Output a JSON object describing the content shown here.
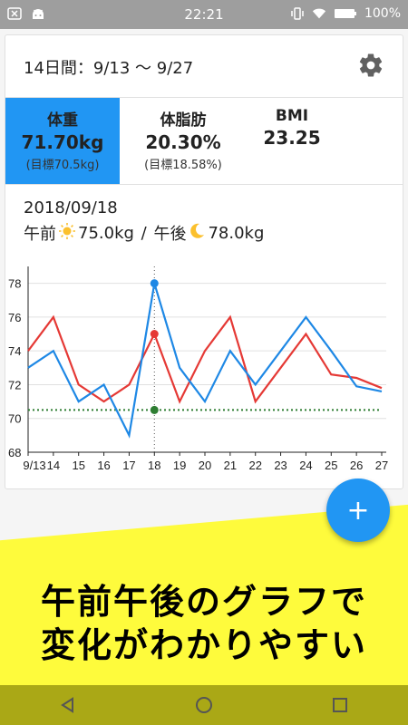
{
  "status": {
    "time": "22:21",
    "battery": "100%"
  },
  "header": {
    "period": "14日間：9/13 〜 9/27"
  },
  "stats": [
    {
      "label": "体重",
      "value": "71.70kg",
      "goal": "(目標70.5kg)"
    },
    {
      "label": "体脂肪",
      "value": "20.30%",
      "goal": "(目標18.58%)"
    },
    {
      "label": "BMI",
      "value": "23.25",
      "goal": ""
    }
  ],
  "detail": {
    "date": "2018/09/18",
    "am_label": "午前",
    "am_value": "75.0kg",
    "separator": " / ",
    "pm_label": "午後",
    "pm_value": "78.0kg"
  },
  "chart_data": {
    "type": "line",
    "categories": [
      "9/13",
      "14",
      "15",
      "16",
      "17",
      "18",
      "19",
      "20",
      "21",
      "22",
      "23",
      "24",
      "25",
      "26",
      "27"
    ],
    "series": [
      {
        "name": "",
        "color": "#e53935",
        "values": [
          74,
          76,
          72,
          71,
          72,
          75,
          71,
          74,
          76,
          71,
          73,
          75,
          72.6,
          72.4,
          71.8
        ]
      },
      {
        "name": "",
        "color": "#1e88e5",
        "values": [
          73,
          74,
          71,
          72,
          69,
          78,
          73,
          71,
          74,
          72,
          74,
          76,
          74,
          71.9,
          71.6
        ]
      }
    ],
    "goal_line": {
      "value": 70.5,
      "color": "#2e7d32"
    },
    "selected_index": 5,
    "yticks": [
      68,
      70,
      72,
      74,
      76,
      78
    ],
    "ylim": [
      68,
      79
    ],
    "grid": true
  },
  "banner": {
    "line1": "午前午後のグラフで",
    "line2": "変化がわかりやすい"
  },
  "fab": {
    "label": "+"
  }
}
